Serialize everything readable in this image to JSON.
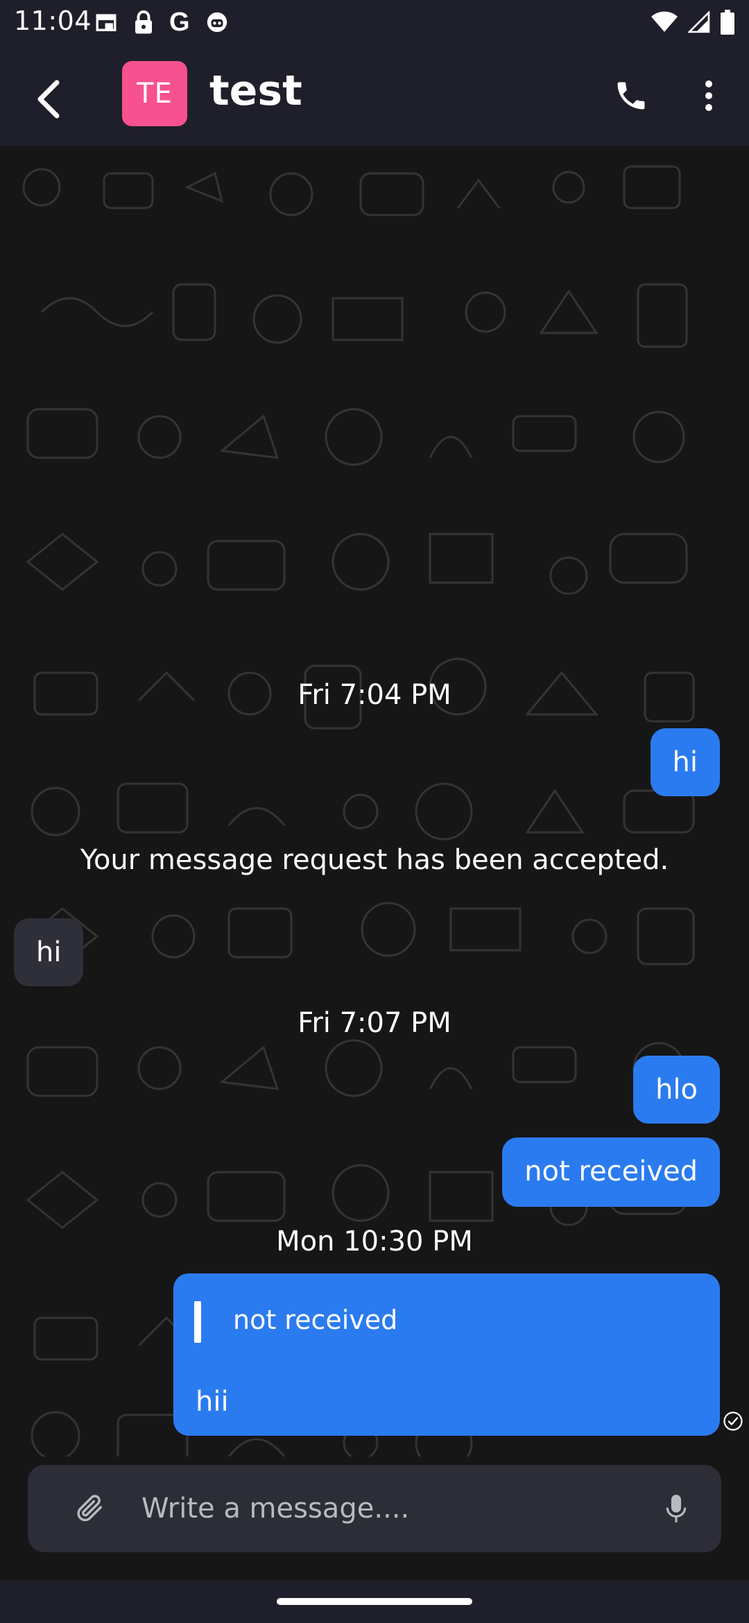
{
  "status_bar": {
    "time": "11:04",
    "icons_left": [
      "calendar-icon",
      "lock-icon",
      "google-icon",
      "bot-icon"
    ],
    "google_letter": "G",
    "icons_right": [
      "wifi-icon",
      "signal-icon",
      "battery-icon"
    ]
  },
  "header": {
    "avatar_initials": "TE",
    "avatar_color": "#f7518f",
    "title": "test",
    "icons": [
      "back-arrow-icon",
      "phone-icon",
      "more-vertical-icon"
    ]
  },
  "chat": {
    "items": [
      {
        "type": "timestamp",
        "text": "Fri 7:04 PM"
      },
      {
        "type": "outgoing",
        "text": "hi"
      },
      {
        "type": "system",
        "text": "Your message request has been accepted."
      },
      {
        "type": "incoming",
        "text": "hi"
      },
      {
        "type": "timestamp",
        "text": "Fri 7:07 PM"
      },
      {
        "type": "outgoing",
        "text": "hlo"
      },
      {
        "type": "outgoing",
        "text": "not received"
      },
      {
        "type": "timestamp",
        "text": "Mon 10:30 PM"
      },
      {
        "type": "outgoing-reply",
        "quoted": "not received",
        "text": "hii",
        "status": "delivered"
      }
    ],
    "colors": {
      "outgoing_bubble": "#2b7bf0",
      "incoming_bubble": "#2f2f3a"
    }
  },
  "composer": {
    "placeholder": "Write a message....",
    "value": "",
    "icons": [
      "paperclip-icon",
      "mic-icon"
    ]
  }
}
